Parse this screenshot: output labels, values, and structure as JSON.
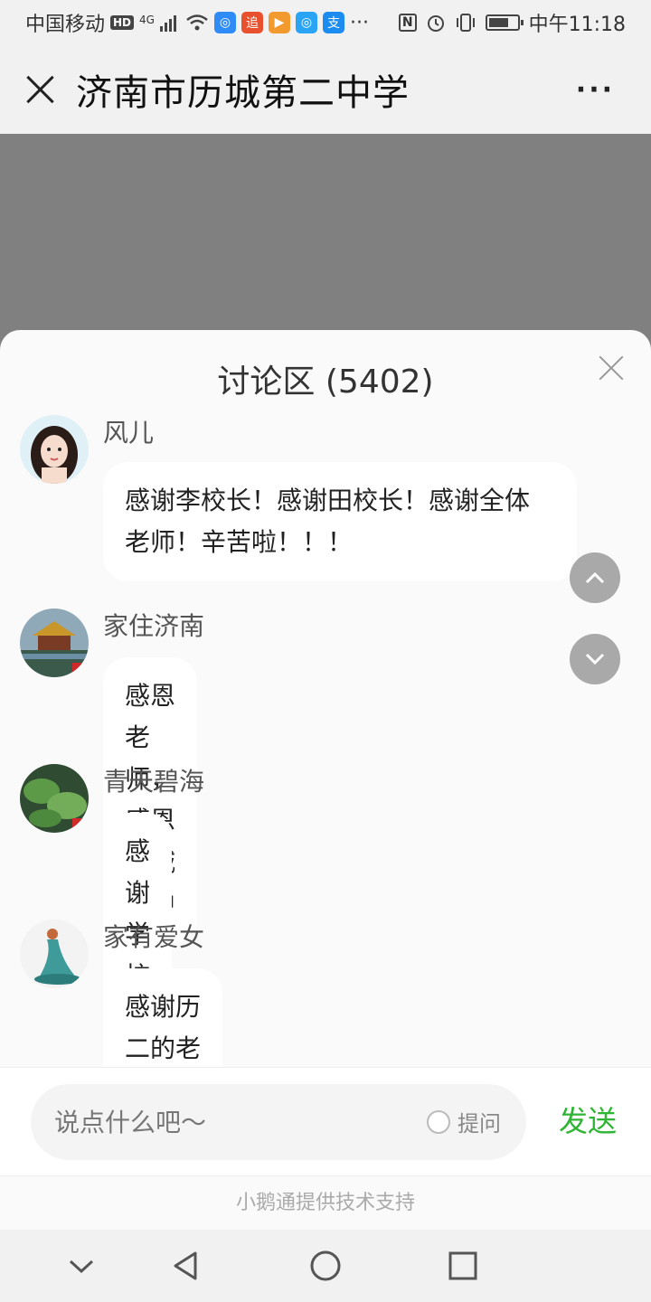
{
  "status_bar": {
    "carrier": "中国移动",
    "hd": "HD",
    "network": "4G",
    "time": "中午11:18",
    "app_icons": [
      "search-app-icon",
      "zhui-app-icon",
      "video-app-icon",
      "browser-app-icon",
      "alipay-app-icon"
    ],
    "zhui_label": "追",
    "alipay_label": "支",
    "more_dots": "···",
    "nfc_label": "N",
    "battery_level": 0.7
  },
  "nav": {
    "title": "济南市历城第二中学",
    "more_label": "···"
  },
  "discussion": {
    "title": "讨论区 (5402)",
    "messages": [
      {
        "user": "风儿",
        "text": "感谢李校长！感谢田校长！感谢全体\n老师！辛苦啦！！！"
      },
      {
        "user": "家住济南",
        "text": "感恩老师，感恩历城二中"
      },
      {
        "user": "青天碧海",
        "text": "感谢学校感谢老师们"
      },
      {
        "user": "家有爱女",
        "text": "感谢历二的老师们！！"
      }
    ]
  },
  "composer": {
    "placeholder": "说点什么吧～",
    "question_label": "提问",
    "send_label": "发送"
  },
  "footer": {
    "text": "小鹅通提供技术支持"
  },
  "colors": {
    "send": "#2eb533",
    "overlay": "#808080",
    "sheet": "#fafafa"
  }
}
